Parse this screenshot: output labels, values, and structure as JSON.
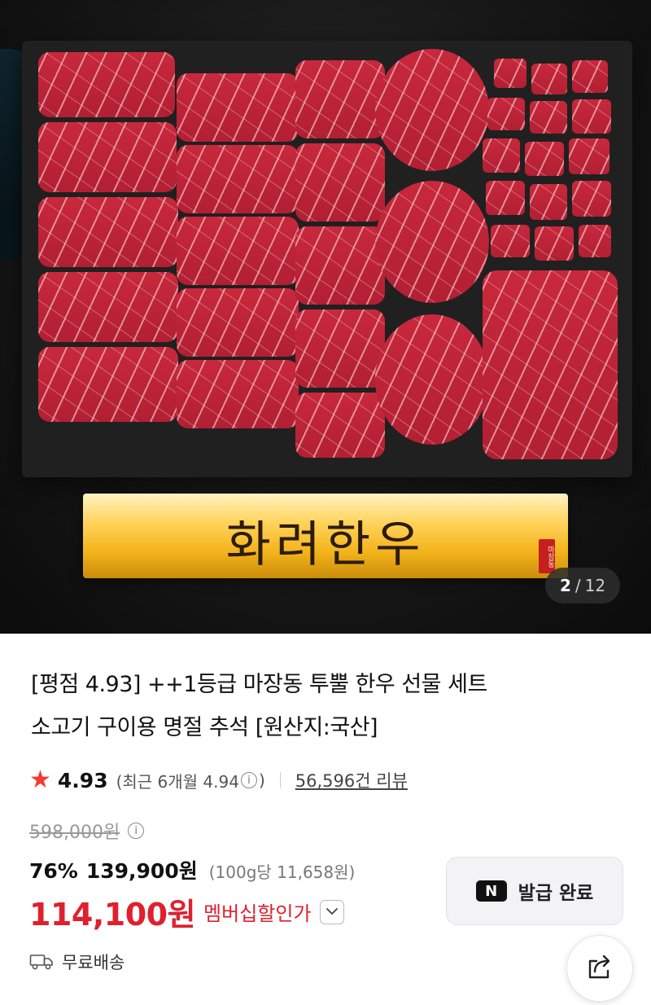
{
  "gallery": {
    "banner_text": "화려한우",
    "seal_text": "마장동",
    "current": "2",
    "separator": "/",
    "total": "12"
  },
  "product": {
    "title_line1": "[평점 4.93] ++1등급 마장동 투뿔 한우 선물 세트",
    "title_line2": "소고기 구이용 명절 추석 [원산지:국산]",
    "rating": "4.93",
    "recent_rating_prefix": "(최근 6개월 4.94",
    "recent_rating_suffix": ")",
    "review_count": "56,596건 리뷰",
    "original_price": "598,000원",
    "discount_rate": "76%",
    "sale_price": "139,900원",
    "unit_price": "(100g당 11,658원)",
    "member_price": "114,100원",
    "member_label": "멤버십할인가"
  },
  "coupon": {
    "label": "발급 완료",
    "badge": "N"
  },
  "shipping": {
    "label": "무료배송"
  },
  "icons": {
    "star": "star-icon",
    "info": "info-icon",
    "chevron": "chevron-down-icon",
    "truck": "truck-icon",
    "share": "share-icon",
    "naver": "naver-n-icon"
  },
  "colors": {
    "accent_red": "#e0202f",
    "star": "#f23c2f"
  }
}
